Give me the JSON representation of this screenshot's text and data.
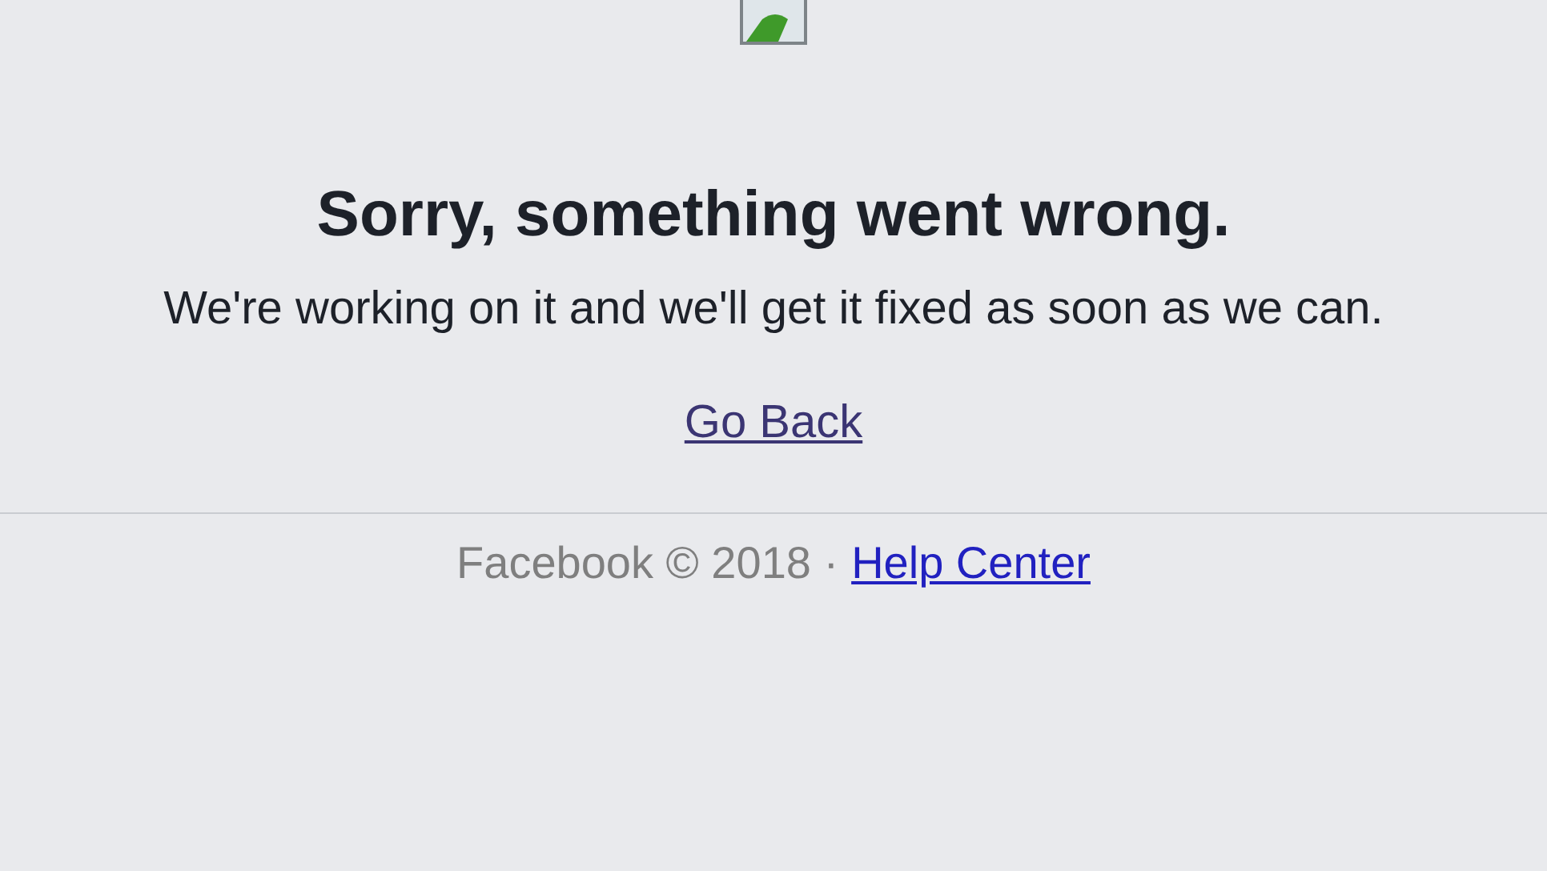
{
  "heading": "Sorry, something went wrong.",
  "message": "We're working on it and we'll get it fixed as soon as we can.",
  "back_link": "Go Back",
  "footer": {
    "copyright": "Facebook © 2018 ·",
    "help_link": "Help Center"
  }
}
